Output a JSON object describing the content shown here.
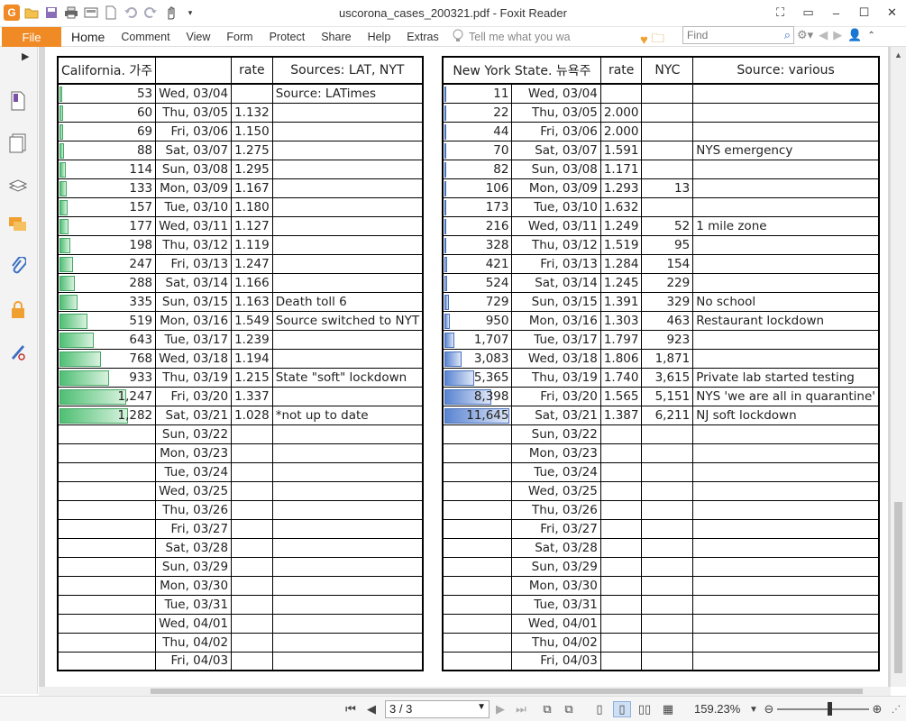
{
  "window": {
    "title": "uscorona_cases_200321.pdf - Foxit Reader",
    "app_logo": "G"
  },
  "ribbon": {
    "file_label": "File",
    "tabs": [
      "Home",
      "Comment",
      "View",
      "Form",
      "Protect",
      "Share",
      "Help",
      "Extras"
    ],
    "tell_me_placeholder": "Tell me what you wa",
    "find_placeholder": "Find"
  },
  "status": {
    "page_value": "3 / 3",
    "zoom": "159.23%"
  },
  "california": {
    "headers": [
      "California. 가주",
      "rate",
      "Sources: LAT, NYT"
    ],
    "max": 1282,
    "rows": [
      {
        "cases": "53",
        "n": 53,
        "date": "Wed, 03/04",
        "rate": "",
        "note": "Source: LATimes"
      },
      {
        "cases": "60",
        "n": 60,
        "date": "Thu, 03/05",
        "rate": "1.132",
        "note": ""
      },
      {
        "cases": "69",
        "n": 69,
        "date": "Fri, 03/06",
        "rate": "1.150",
        "note": ""
      },
      {
        "cases": "88",
        "n": 88,
        "date": "Sat, 03/07",
        "rate": "1.275",
        "note": ""
      },
      {
        "cases": "114",
        "n": 114,
        "date": "Sun, 03/08",
        "rate": "1.295",
        "note": ""
      },
      {
        "cases": "133",
        "n": 133,
        "date": "Mon, 03/09",
        "rate": "1.167",
        "note": ""
      },
      {
        "cases": "157",
        "n": 157,
        "date": "Tue, 03/10",
        "rate": "1.180",
        "note": ""
      },
      {
        "cases": "177",
        "n": 177,
        "date": "Wed, 03/11",
        "rate": "1.127",
        "note": ""
      },
      {
        "cases": "198",
        "n": 198,
        "date": "Thu, 03/12",
        "rate": "1.119",
        "note": ""
      },
      {
        "cases": "247",
        "n": 247,
        "date": "Fri, 03/13",
        "rate": "1.247",
        "note": ""
      },
      {
        "cases": "288",
        "n": 288,
        "date": "Sat, 03/14",
        "rate": "1.166",
        "note": ""
      },
      {
        "cases": "335",
        "n": 335,
        "date": "Sun, 03/15",
        "rate": "1.163",
        "note": "Death toll 6"
      },
      {
        "cases": "519",
        "n": 519,
        "date": "Mon, 03/16",
        "rate": "1.549",
        "note": "Source switched to NYT"
      },
      {
        "cases": "643",
        "n": 643,
        "date": "Tue, 03/17",
        "rate": "1.239",
        "note": ""
      },
      {
        "cases": "768",
        "n": 768,
        "date": "Wed, 03/18",
        "rate": "1.194",
        "note": ""
      },
      {
        "cases": "933",
        "n": 933,
        "date": "Thu, 03/19",
        "rate": "1.215",
        "note": "State \"soft\" lockdown"
      },
      {
        "cases": "1,247",
        "n": 1247,
        "date": "Fri, 03/20",
        "rate": "1.337",
        "note": ""
      },
      {
        "cases": "1,282",
        "n": 1282,
        "date": "Sat, 03/21",
        "rate": "1.028",
        "note": "*not up to date"
      },
      {
        "cases": "",
        "n": 0,
        "date": "Sun, 03/22",
        "rate": "",
        "note": ""
      },
      {
        "cases": "",
        "n": 0,
        "date": "Mon, 03/23",
        "rate": "",
        "note": ""
      },
      {
        "cases": "",
        "n": 0,
        "date": "Tue, 03/24",
        "rate": "",
        "note": ""
      },
      {
        "cases": "",
        "n": 0,
        "date": "Wed, 03/25",
        "rate": "",
        "note": ""
      },
      {
        "cases": "",
        "n": 0,
        "date": "Thu, 03/26",
        "rate": "",
        "note": ""
      },
      {
        "cases": "",
        "n": 0,
        "date": "Fri, 03/27",
        "rate": "",
        "note": ""
      },
      {
        "cases": "",
        "n": 0,
        "date": "Sat, 03/28",
        "rate": "",
        "note": ""
      },
      {
        "cases": "",
        "n": 0,
        "date": "Sun, 03/29",
        "rate": "",
        "note": ""
      },
      {
        "cases": "",
        "n": 0,
        "date": "Mon, 03/30",
        "rate": "",
        "note": ""
      },
      {
        "cases": "",
        "n": 0,
        "date": "Tue, 03/31",
        "rate": "",
        "note": ""
      },
      {
        "cases": "",
        "n": 0,
        "date": "Wed, 04/01",
        "rate": "",
        "note": ""
      },
      {
        "cases": "",
        "n": 0,
        "date": "Thu, 04/02",
        "rate": "",
        "note": ""
      },
      {
        "cases": "",
        "n": 0,
        "date": "Fri, 04/03",
        "rate": "",
        "note": ""
      }
    ]
  },
  "newyork": {
    "headers": [
      "New York State. 뉴욕주",
      "rate",
      "NYC",
      "Source: various"
    ],
    "max": 11645,
    "rows": [
      {
        "cases": "11",
        "n": 11,
        "date": "Wed, 03/04",
        "rate": "",
        "nyc": "",
        "note": ""
      },
      {
        "cases": "22",
        "n": 22,
        "date": "Thu, 03/05",
        "rate": "2.000",
        "nyc": "",
        "note": ""
      },
      {
        "cases": "44",
        "n": 44,
        "date": "Fri, 03/06",
        "rate": "2.000",
        "nyc": "",
        "note": ""
      },
      {
        "cases": "70",
        "n": 70,
        "date": "Sat, 03/07",
        "rate": "1.591",
        "nyc": "",
        "note": "NYS emergency"
      },
      {
        "cases": "82",
        "n": 82,
        "date": "Sun, 03/08",
        "rate": "1.171",
        "nyc": "",
        "note": ""
      },
      {
        "cases": "106",
        "n": 106,
        "date": "Mon, 03/09",
        "rate": "1.293",
        "nyc": "13",
        "note": ""
      },
      {
        "cases": "173",
        "n": 173,
        "date": "Tue, 03/10",
        "rate": "1.632",
        "nyc": "",
        "note": ""
      },
      {
        "cases": "216",
        "n": 216,
        "date": "Wed, 03/11",
        "rate": "1.249",
        "nyc": "52",
        "note": "1 mile zone"
      },
      {
        "cases": "328",
        "n": 328,
        "date": "Thu, 03/12",
        "rate": "1.519",
        "nyc": "95",
        "note": ""
      },
      {
        "cases": "421",
        "n": 421,
        "date": "Fri, 03/13",
        "rate": "1.284",
        "nyc": "154",
        "note": ""
      },
      {
        "cases": "524",
        "n": 524,
        "date": "Sat, 03/14",
        "rate": "1.245",
        "nyc": "229",
        "note": ""
      },
      {
        "cases": "729",
        "n": 729,
        "date": "Sun, 03/15",
        "rate": "1.391",
        "nyc": "329",
        "note": "No school"
      },
      {
        "cases": "950",
        "n": 950,
        "date": "Mon, 03/16",
        "rate": "1.303",
        "nyc": "463",
        "note": "Restaurant lockdown"
      },
      {
        "cases": "1,707",
        "n": 1707,
        "date": "Tue, 03/17",
        "rate": "1.797",
        "nyc": "923",
        "note": ""
      },
      {
        "cases": "3,083",
        "n": 3083,
        "date": "Wed, 03/18",
        "rate": "1.806",
        "nyc": "1,871",
        "note": ""
      },
      {
        "cases": "5,365",
        "n": 5365,
        "date": "Thu, 03/19",
        "rate": "1.740",
        "nyc": "3,615",
        "note": "Private lab started testing"
      },
      {
        "cases": "8,398",
        "n": 8398,
        "date": "Fri, 03/20",
        "rate": "1.565",
        "nyc": "5,151",
        "note": "NYS 'we are all in quarantine'"
      },
      {
        "cases": "11,645",
        "n": 11645,
        "date": "Sat, 03/21",
        "rate": "1.387",
        "nyc": "6,211",
        "note": "NJ soft lockdown"
      },
      {
        "cases": "",
        "n": 0,
        "date": "Sun, 03/22",
        "rate": "",
        "nyc": "",
        "note": ""
      },
      {
        "cases": "",
        "n": 0,
        "date": "Mon, 03/23",
        "rate": "",
        "nyc": "",
        "note": ""
      },
      {
        "cases": "",
        "n": 0,
        "date": "Tue, 03/24",
        "rate": "",
        "nyc": "",
        "note": ""
      },
      {
        "cases": "",
        "n": 0,
        "date": "Wed, 03/25",
        "rate": "",
        "nyc": "",
        "note": ""
      },
      {
        "cases": "",
        "n": 0,
        "date": "Thu, 03/26",
        "rate": "",
        "nyc": "",
        "note": ""
      },
      {
        "cases": "",
        "n": 0,
        "date": "Fri, 03/27",
        "rate": "",
        "nyc": "",
        "note": ""
      },
      {
        "cases": "",
        "n": 0,
        "date": "Sat, 03/28",
        "rate": "",
        "nyc": "",
        "note": ""
      },
      {
        "cases": "",
        "n": 0,
        "date": "Sun, 03/29",
        "rate": "",
        "nyc": "",
        "note": ""
      },
      {
        "cases": "",
        "n": 0,
        "date": "Mon, 03/30",
        "rate": "",
        "nyc": "",
        "note": ""
      },
      {
        "cases": "",
        "n": 0,
        "date": "Tue, 03/31",
        "rate": "",
        "nyc": "",
        "note": ""
      },
      {
        "cases": "",
        "n": 0,
        "date": "Wed, 04/01",
        "rate": "",
        "nyc": "",
        "note": ""
      },
      {
        "cases": "",
        "n": 0,
        "date": "Thu, 04/02",
        "rate": "",
        "nyc": "",
        "note": ""
      },
      {
        "cases": "",
        "n": 0,
        "date": "Fri, 04/03",
        "rate": "",
        "nyc": "",
        "note": ""
      }
    ]
  }
}
